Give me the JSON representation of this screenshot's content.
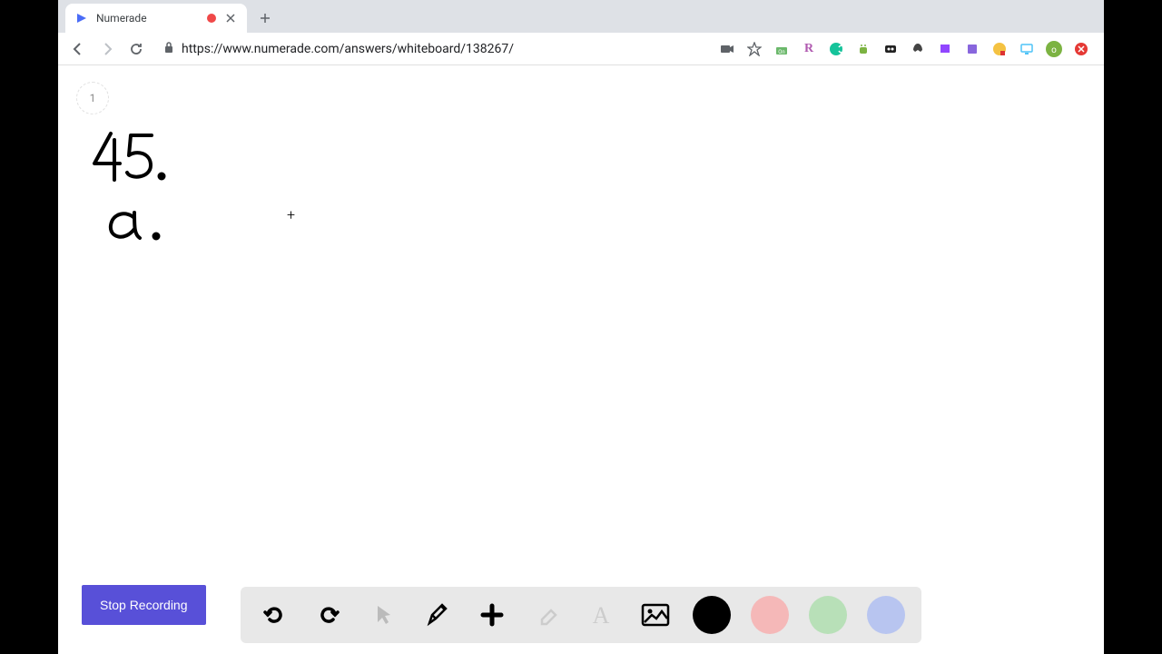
{
  "tab": {
    "title": "Numerade"
  },
  "url": {
    "display": "https://www.numerade.com/answers/whiteboard/138267/"
  },
  "whiteboard": {
    "page_number": "1",
    "cursor_glyph": "+"
  },
  "buttons": {
    "stop_recording": "Stop Recording"
  }
}
